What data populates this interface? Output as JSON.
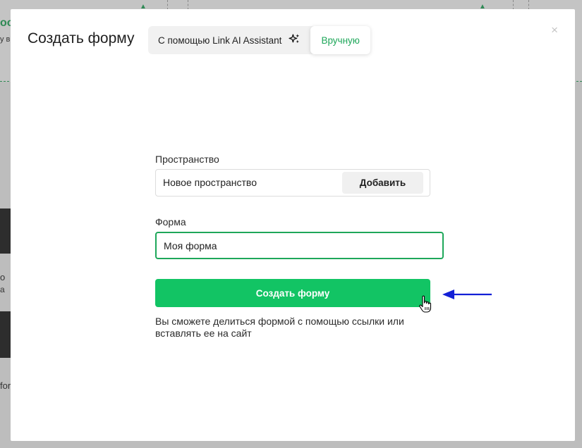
{
  "modal": {
    "title": "Создать форму",
    "mode_ai_label": "С помощью Link AI Assistant",
    "mode_manual_label": "Вручную",
    "close_symbol": "×"
  },
  "space": {
    "label": "Пространство",
    "value": "Новое пространство",
    "add_button": "Добавить"
  },
  "form": {
    "label": "Форма",
    "value": "Моя форма"
  },
  "create_button": "Создать форму",
  "hint": "Вы сможете делиться формой с помощью ссылки или вставлять ее на сайт",
  "background_fragments": {
    "text_1": "оо",
    "text_2": "у в",
    "text_3": "о",
    "text_4": "а",
    "text_5": "for"
  },
  "icons": [
    "sparkles-icon",
    "close-icon",
    "hand-pointer-icon",
    "arrow-left-icon"
  ],
  "colors": {
    "accent_green": "#12c464",
    "manual_green": "#1ea75a",
    "arrow_blue": "#1320d6"
  }
}
